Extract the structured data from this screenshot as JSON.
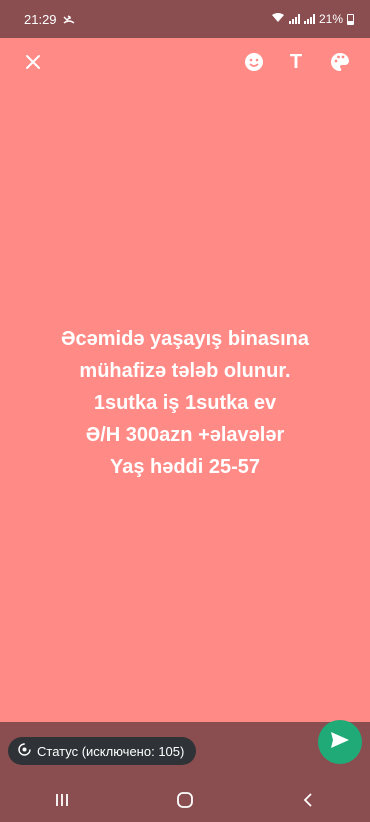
{
  "status_bar": {
    "time": "21:29",
    "battery": "21%"
  },
  "icons": {
    "close": "close-icon",
    "emoji": "emoji-icon",
    "text": "T",
    "palette": "palette-icon",
    "send": "send-icon"
  },
  "colors": {
    "background": "#ff8a86",
    "bar": "#8a4e50",
    "send": "#1faa77",
    "pill": "#2f3337"
  },
  "status_text": {
    "line1": "Əcəmidə yaşayış binasına",
    "line2": "mühafizə tələb olunur.",
    "line3": "1sutka iş 1sutka ev",
    "line4": "Ə/H 300azn +əlavələr",
    "line5": "Yaş həddi 25-57"
  },
  "footer": {
    "audience_label": "Статус (исключено: 105)"
  }
}
